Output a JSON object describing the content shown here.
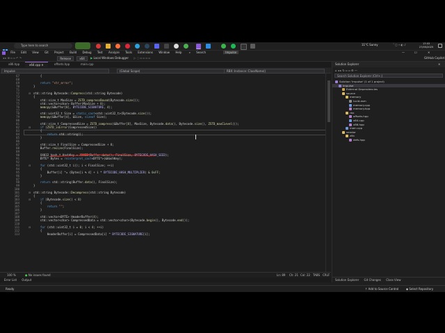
{
  "taskbar": {
    "search_placeholder": "Type here to search",
    "weather": "11°C  Sunny",
    "time": "17:03",
    "date": "27/05/2025"
  },
  "menubar": {
    "items": [
      "File",
      "Edit",
      "View",
      "Git",
      "Project",
      "Build",
      "Debug",
      "Test",
      "Analyze",
      "Tools",
      "Extensions",
      "Window",
      "Help"
    ],
    "search_label": "Search",
    "project_name": "Impulse",
    "account_label": "GitHub Copilot"
  },
  "toolbar": {
    "configuration": "Release",
    "platform": "x64",
    "debugger": "Local Windows Debugger"
  },
  "tabs": [
    {
      "label": "x86.hpp",
      "active": false
    },
    {
      "label": "x64.cpp",
      "active": true
    },
    {
      "label": "offsets.hpp",
      "active": false
    },
    {
      "label": "main.cpp",
      "active": false
    }
  ],
  "nav": {
    "project": "Impulse",
    "scope": "(Global Scope)",
    "member": "RBX::Instance::ClassName()"
  },
  "editor": {
    "zoom": "100 %",
    "issues": "No issues found",
    "position": {
      "ln": "Ln: 89",
      "ch": "Ch: 21",
      "col": "Col: 22",
      "mode": "TABS",
      "eol": "CRLF"
    }
  },
  "output_tabs": [
    "Error List",
    "Output"
  ],
  "solution_explorer": {
    "title": "Solution Explorer",
    "search_placeholder": "Search Solution Explorer (Ctrl+;)",
    "tree": [
      {
        "label": "Solution 'Impulse' (1 of 1 project)",
        "level": 0,
        "color": "#9b7fd0"
      },
      {
        "label": "Impulse",
        "level": 1,
        "color": "#8f7fd0",
        "sel": true
      },
      {
        "label": "External Dependencies",
        "level": 2,
        "color": "#c8a24a"
      },
      {
        "label": "source",
        "level": 2,
        "color": "#dcb862"
      },
      {
        "label": "memory",
        "level": 3,
        "color": "#dcb862"
      },
      {
        "label": "lucid.asm",
        "level": 4,
        "color": "#8c8c8c"
      },
      {
        "label": "memory.cpp",
        "level": 4,
        "color": "#6a9ad8"
      },
      {
        "label": "memory.hpp",
        "level": 4,
        "color": "#b07cc6"
      },
      {
        "label": "rbx",
        "level": 3,
        "color": "#dcb862"
      },
      {
        "label": "offsets.hpp",
        "level": 4,
        "color": "#b07cc6"
      },
      {
        "label": "x64.cpp",
        "level": 4,
        "color": "#6a9ad8"
      },
      {
        "label": "x86.hpp",
        "level": 4,
        "color": "#b07cc6"
      },
      {
        "label": "main.cpp",
        "level": 3,
        "color": "#6a9ad8"
      },
      {
        "label": "vendor",
        "level": 2,
        "color": "#dcb862"
      },
      {
        "label": "zlib",
        "level": 3,
        "color": "#dcb862"
      },
      {
        "label": "defs.hpp",
        "level": 4,
        "color": "#b07cc6"
      }
    ],
    "bottom_tabs": [
      "Solution Explorer",
      "Git Changes",
      "Class View"
    ]
  },
  "statusbar": {
    "ready": "Ready",
    "source_control": "Add to Source Control",
    "repository": "Select Repository"
  },
  "code_lines": [
    {
      "n": "67",
      "t": "    {"
    },
    {
      "n": "68",
      "t": "        "
    },
    {
      "n": "69",
      "t": "    return \"str_error\";"
    },
    {
      "n": "70",
      "t": "}"
    },
    {
      "n": "71",
      "t": ""
    },
    {
      "n": "72",
      "t": "std::string Bytecode::Compress(std::string Bytecode)"
    },
    {
      "n": "73",
      "t": "{"
    },
    {
      "n": "74",
      "t": "    std::size_t MaxSize = ZSTD_compressBound(Bytecode.size());"
    },
    {
      "n": "75",
      "t": "    std::vector<char> Buffer(MaxSize + 8);"
    },
    {
      "n": "76",
      "t": "    memcpy(&Buffer[0], BYTECODE_SIGNATURE, 4);"
    },
    {
      "n": "77",
      "t": ""
    },
    {
      "n": "78",
      "t": "    std::uint32_t Size = static_cast<std::uint32_t>(Bytecode.size());"
    },
    {
      "n": "79",
      "t": "    memcpy(&Buffer[4], &Size, sizeof Size);"
    },
    {
      "n": "80",
      "t": ""
    },
    {
      "n": "81",
      "t": "    std::size_t CompressedSize = ZSTD_compress(&Buffer[8], MaxSize, Bytecode.data(), Bytecode.size(), ZSTD_maxCLevel());"
    },
    {
      "n": "82",
      "t": "    if (ZSTD_isError(CompressedSize))"
    },
    {
      "n": "83",
      "t": "    {"
    },
    {
      "n": "84",
      "t": "        return std::string();"
    },
    {
      "n": "85",
      "t": "    }"
    },
    {
      "n": "86",
      "t": ""
    },
    {
      "n": "87",
      "t": "    std::size_t FinalSize = CompressedSize + 8;"
    },
    {
      "n": "88",
      "t": "    Buffer.resize(FinalSize);"
    },
    {
      "n": "89",
      "t": ""
    },
    {
      "n": "90",
      "t": "    XXH32_hash_t HashKey = XXH32(Buffer.data(), FinalSize, BYTECODE_HASH_SEED);"
    },
    {
      "n": "91",
      "t": "    BYTE* Bytes = reinterpret_cast<BYTE*>(&HashKey);"
    },
    {
      "n": "92",
      "t": ""
    },
    {
      "n": "93",
      "t": "    for (std::uint32_t i(); i < FinalSize; ++i)"
    },
    {
      "n": "94",
      "t": "    {"
    },
    {
      "n": "95",
      "t": "        Buffer[i] ^= (Bytes[i % 4] + i * BYTECODE_HASH_MULTIPLIER) & 0xFF;"
    },
    {
      "n": "96",
      "t": "    }"
    },
    {
      "n": "97",
      "t": ""
    },
    {
      "n": "98",
      "t": "    return std::string(Buffer.data(), FinalSize);"
    },
    {
      "n": "99",
      "t": "}"
    },
    {
      "n": "100",
      "t": ""
    },
    {
      "n": "101",
      "t": "std::string Bytecode::Decompress(std::string Bytecode)"
    },
    {
      "n": "102",
      "t": "{"
    },
    {
      "n": "103",
      "t": "    if (Bytecode.size() < 8)"
    },
    {
      "n": "104",
      "t": "    {"
    },
    {
      "n": "105",
      "t": "        return \"\";"
    },
    {
      "n": "106",
      "t": "    }"
    },
    {
      "n": "107",
      "t": ""
    },
    {
      "n": "108",
      "t": "    std::vector<BYTE> HeaderBuffer(4);"
    },
    {
      "n": "109",
      "t": "    std::vector<char> CompressedData = std::vector<char>(Bytecode.begin(), Bytecode.end());"
    },
    {
      "n": "110",
      "t": ""
    },
    {
      "n": "111",
      "t": "    for (std::uint32_t i = 0; i < 4; ++i)"
    },
    {
      "n": "112",
      "t": "    {"
    },
    {
      "n": "113",
      "t": "        HeaderBuffer[i] = CompressedData[i] ^ BYTECODE_SIGNATURE[i];"
    }
  ]
}
